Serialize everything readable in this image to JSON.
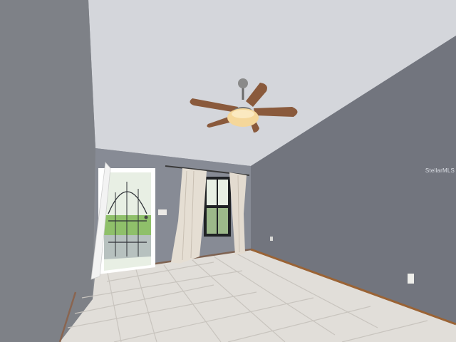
{
  "photo": {
    "watermark": "StellarMLS",
    "colors": {
      "ceiling": "#d5d7dc",
      "left_wall": "#7f8288",
      "back_wall": "#878b95",
      "right_wall": "#73767f",
      "floor": "#e2dfdb",
      "grout": "#c9c5c0",
      "baseboard": "#9a6335",
      "door_frame": "#ffffff",
      "curtain": "#e5ded3",
      "fan_blade": "#8a5a3c",
      "fan_light": "#f5d79a",
      "window_light": "#e8efe4",
      "grass": "#8fc06a"
    },
    "icons": [
      "ceiling-fan-icon",
      "wall-outlet-icon",
      "light-switch-icon"
    ]
  }
}
